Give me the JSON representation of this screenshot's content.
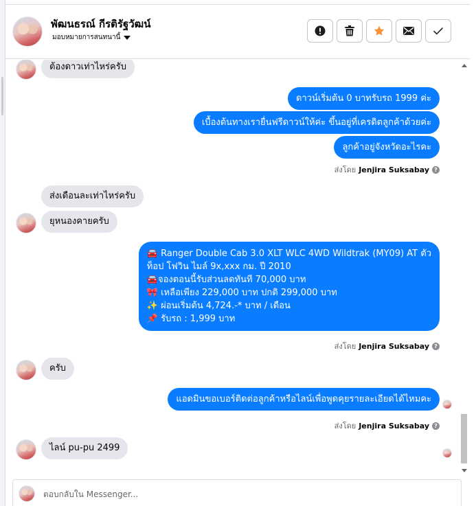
{
  "header": {
    "contact_name": "พัฒนธรณ์ กีรติรัฐวัฒน์",
    "assign_label": "มอบหมายการสนทนานี้",
    "actions": [
      {
        "name": "report",
        "icon": "alert-circle-icon"
      },
      {
        "name": "delete",
        "icon": "trash-icon"
      },
      {
        "name": "star",
        "icon": "star-icon"
      },
      {
        "name": "mark-unread",
        "icon": "envelope-icon"
      },
      {
        "name": "mark-done",
        "icon": "check-icon"
      }
    ]
  },
  "messages": [
    {
      "dir": "in",
      "text": "ต้องดาวเท่าไหร่ครับ"
    },
    {
      "dir": "out",
      "text": "ดาวน์เริ่มต้น 0 บาทรับรถ 1999 ค่ะ"
    },
    {
      "dir": "out",
      "text": "เบื้องต้นทางเรายื่นฟรีดาวน์ให้ค่ะ ขึ้นอยู่ที่เครดิตลูกค้าด้วยค่ะ"
    },
    {
      "dir": "out",
      "text": "ลูกค้าอยู่จังหวัดอะไรคะ"
    },
    {
      "dir": "sent_by",
      "prefix": "ส่งโดย",
      "agent": "Jenjira Suksabay"
    },
    {
      "dir": "in",
      "text": "ส่งเดือนละเท่าไหร่ครับ"
    },
    {
      "dir": "in",
      "text": "ยุหนองคายครับ"
    },
    {
      "dir": "out",
      "lines": [
        "🚘 Ranger Double Cab 3.0 XLT WLC 4WD Wildtrak (MY09) AT ตัว",
        "ท็อป โฟวิน ไมล์ 9x,xxx กม. ปี 2010",
        "🚘จองตอนนี้รับส่วนลดทันที 70,000 บาท",
        "🎀 เหลือเพียง 229,000 บาท ปกติ 299,000 บาท",
        "✨ ผ่อนเริ่มต้น 4,724.-* บาท / เดือน",
        "📌 รับรถ : 1,999 บาท"
      ]
    },
    {
      "dir": "sent_by",
      "prefix": "ส่งโดย",
      "agent": "Jenjira Suksabay"
    },
    {
      "dir": "in",
      "text": "ครับ"
    },
    {
      "dir": "out",
      "text": "แอดมินขอเบอร์ติดต่อลูกค้าหรือไลน์เพื่อพูดคุยรายละเอียดได้ไหมคะ"
    },
    {
      "dir": "sent_by",
      "prefix": "ส่งโดย",
      "agent": "Jenjira Suksabay"
    },
    {
      "dir": "in",
      "text": "ไลน์ pu-pu 2499"
    }
  ],
  "composer": {
    "placeholder": "ตอบกลับใน Messenger..."
  },
  "colors": {
    "outgoing_bubble": "#0a7cff",
    "incoming_bubble": "#e4e6eb",
    "star_accent": "#f7923a"
  }
}
